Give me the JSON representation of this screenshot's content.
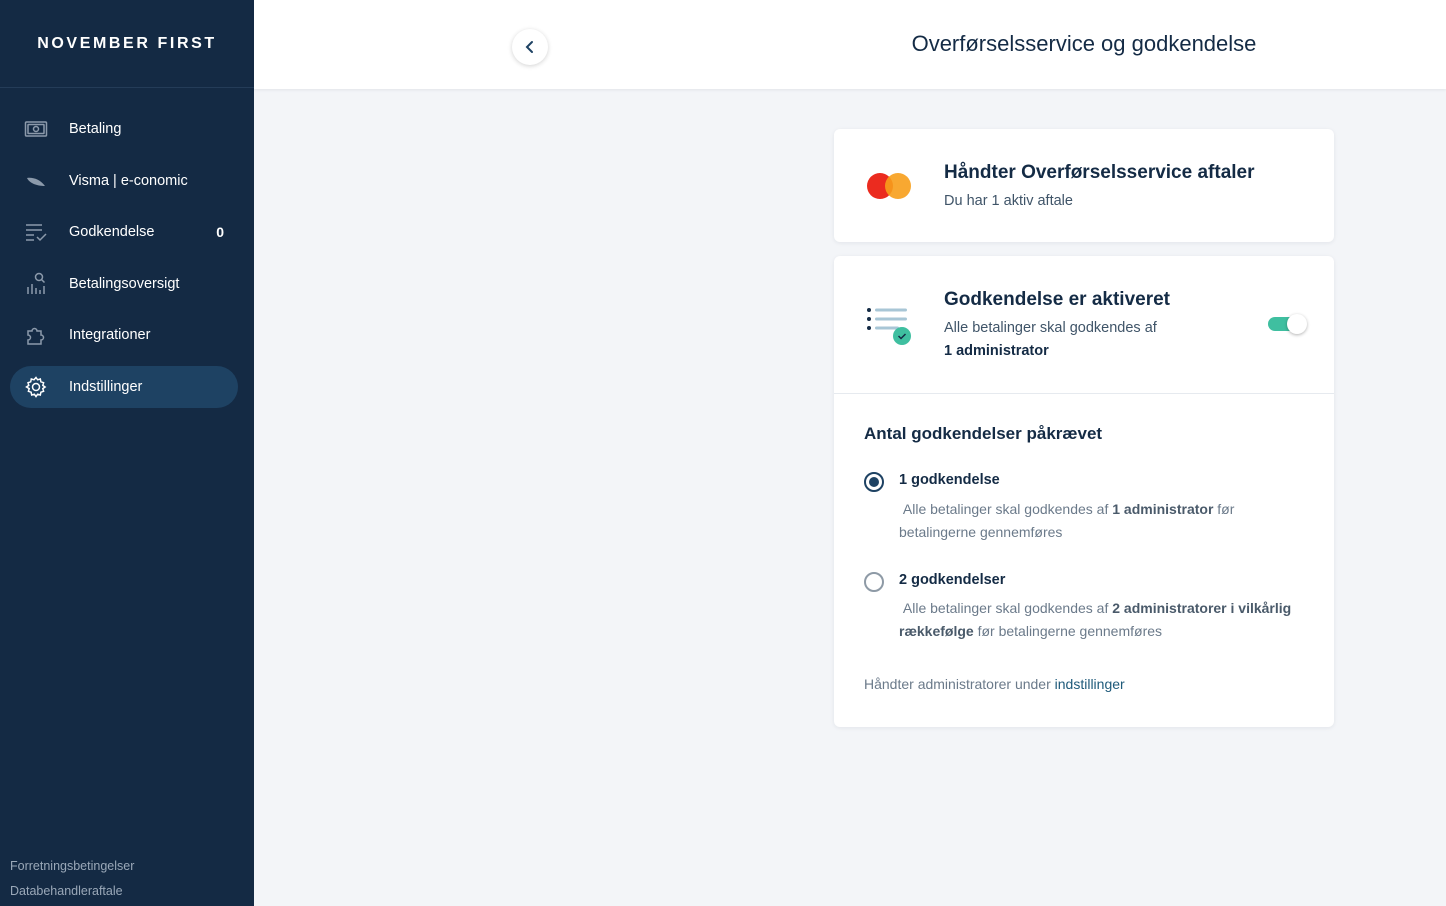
{
  "brand": "NOVEMBER FIRST",
  "sidebar": {
    "items": [
      {
        "label": "Betaling",
        "icon": "banknote-icon"
      },
      {
        "label": "Visma | e-conomic",
        "icon": "visma-leaf-icon"
      },
      {
        "label": "Godkendelse",
        "icon": "list-check-icon",
        "badge": "0"
      },
      {
        "label": "Betalingsoversigt",
        "icon": "chart-user-icon"
      },
      {
        "label": "Integrationer",
        "icon": "puzzle-icon"
      },
      {
        "label": "Indstillinger",
        "icon": "gear-icon",
        "active": true
      }
    ],
    "footer": [
      "Forretningsbetingelser",
      "Databehandleraftale"
    ]
  },
  "header": {
    "title": "Overførselsservice og godkendelse"
  },
  "agreements_card": {
    "title": "Håndter Overførselsservice aftaler",
    "subtitle": "Du har 1 aktiv aftale"
  },
  "approval_card": {
    "title": "Godkendelse er aktiveret",
    "subtitle_prefix": "Alle betalinger skal godkendes af",
    "subtitle_bold": "1 administrator",
    "toggle_on": true,
    "section_title": "Antal godkendelser påkrævet",
    "options": [
      {
        "title": "1 godkendelse",
        "desc_prefix": "Alle betalinger skal godkendes af",
        "desc_bold": "1 administrator",
        "desc_suffix": "før betalingerne gennemføres",
        "selected": true
      },
      {
        "title": "2 godkendelser",
        "desc_prefix": "Alle betalinger skal godkendes af",
        "desc_bold": "2 administratorer i vilkårlig rækkefølge",
        "desc_suffix": "før betalingerne gennemføres",
        "selected": false
      }
    ],
    "manage_text": "Håndter administratorer under",
    "manage_link": "indstillinger"
  },
  "colors": {
    "sidebar_bg": "#142a44",
    "active_item": "#1e4263",
    "toggle_on": "#3fbfa0",
    "mastercard_red": "#eb2b1f",
    "mastercard_orange": "#f79e1b"
  }
}
